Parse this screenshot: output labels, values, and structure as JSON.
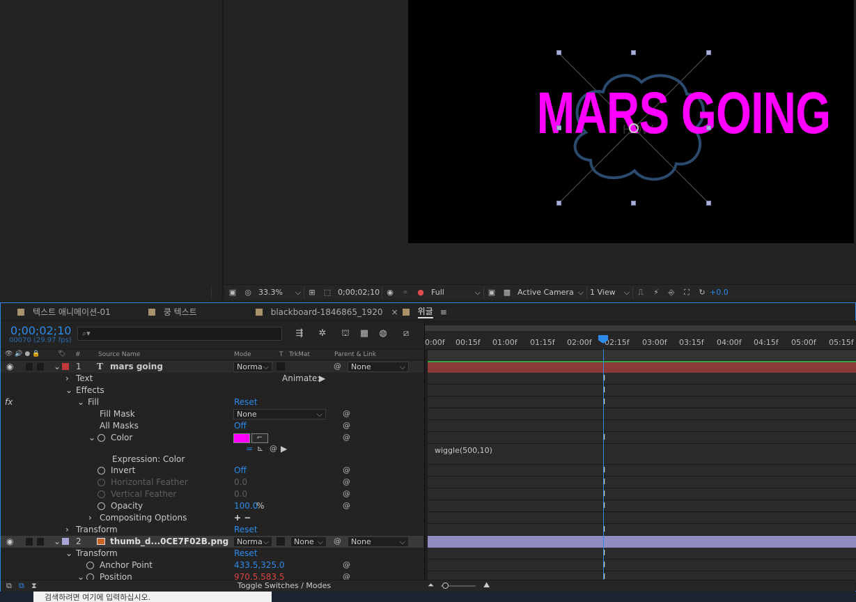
{
  "viewer": {
    "comp_text": "MARS GOING",
    "zoom": "33.3%",
    "timecode": "0;00;02;10",
    "resolution": "Full",
    "camera": "Active Camera",
    "views": "1 View",
    "exposure": "+0.0"
  },
  "tabs": [
    {
      "label": "텍스트 애니메이션-01",
      "active": false
    },
    {
      "label": "쿵 텍스트",
      "active": false
    },
    {
      "label": "blackboard-1846865_1920",
      "active": false,
      "close": "×"
    },
    {
      "label": "위글",
      "active": true,
      "menu": "≡"
    }
  ],
  "timeline": {
    "timecode": "0;00;02;10",
    "frames": "00070 (29.97 fps)",
    "search_placeholder": "⌕▾",
    "columns": {
      "number": "#",
      "source_name": "Source Name",
      "mode": "Mode",
      "t": "T",
      "trkmat": "TrkMat",
      "parent": "Parent & Link"
    },
    "ruler_ticks": [
      "0:00f",
      "00:15f",
      "01:00f",
      "01:15f",
      "02:00f",
      "02:15f",
      "03:00f",
      "03:15f",
      "04:00f",
      "04:15f",
      "05:00f",
      "05:15f"
    ],
    "toggle_label": "Toggle Switches / Modes",
    "layers": {
      "l1_num": "1",
      "l1_name": "mars going",
      "l1_mode": "Norma",
      "l1_parent": "None",
      "animate": "Animate:",
      "text": "Text",
      "effects": "Effects",
      "fx": "fx",
      "fill": "Fill",
      "reset": "Reset",
      "fill_mask": "Fill Mask",
      "fill_mask_val": "None",
      "all_masks": "All Masks",
      "all_masks_val": "Off",
      "color": "Color",
      "color_value": "#ff00ff",
      "expression_label": "Expression: Color",
      "expression": "wiggle(500,10)",
      "invert": "Invert",
      "invert_val": "Off",
      "h_feather": "Horizontal Feather",
      "h_feather_val": "0.0",
      "v_feather": "Vertical Feather",
      "v_feather_val": "0.0",
      "opacity": "Opacity",
      "opacity_val": "100.0",
      "opacity_unit": "%",
      "compositing": "Compositing Options",
      "plus_minus": "+ −",
      "transform": "Transform",
      "l2_num": "2",
      "l2_name": "thumb_d...0CE7F02B.png",
      "l2_mode": "Norma",
      "l2_trkmat": "None",
      "l2_parent": "None",
      "anchor": "Anchor Point",
      "anchor_val": "433.5,325.0",
      "position": "Position",
      "position_val": "970.5,583.5"
    }
  },
  "taskbar": {
    "search_text": "검색하려면 여기에 입력하십시오."
  },
  "colors": {
    "accent": "#2d8ceb",
    "layer1": "#8b3a3a",
    "layer2": "#8e8cc0",
    "magenta": "#ff00ff"
  }
}
